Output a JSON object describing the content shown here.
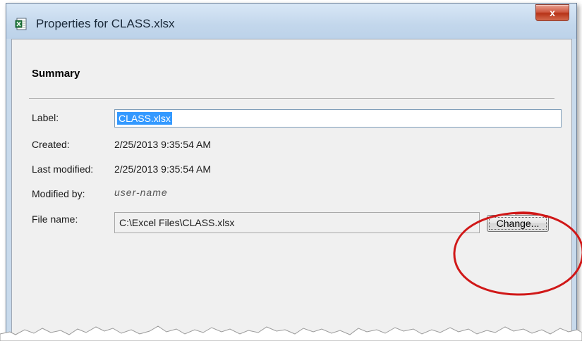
{
  "window": {
    "title": "Properties for CLASS.xlsx",
    "close_label": "x",
    "icon": "excel-file-icon"
  },
  "summary": {
    "heading": "Summary",
    "label": {
      "caption": "Label:",
      "value": "CLASS.xlsx"
    },
    "created": {
      "caption": "Created:",
      "value": "2/25/2013 9:35:54 AM"
    },
    "last_modified": {
      "caption": "Last modified:",
      "value": "2/25/2013 9:35:54 AM"
    },
    "modified_by": {
      "caption": "Modified by:",
      "value": "user-name"
    },
    "file_name": {
      "caption": "File name:",
      "value": "C:\\Excel Files\\CLASS.xlsx"
    },
    "change_button": "Change..."
  },
  "annotation": {
    "shape": "ellipse",
    "color": "#d01818",
    "target": "change-button"
  },
  "colors": {
    "selection": "#3399ff",
    "titlebar": "#c8daec",
    "client": "#f0f0f0"
  }
}
